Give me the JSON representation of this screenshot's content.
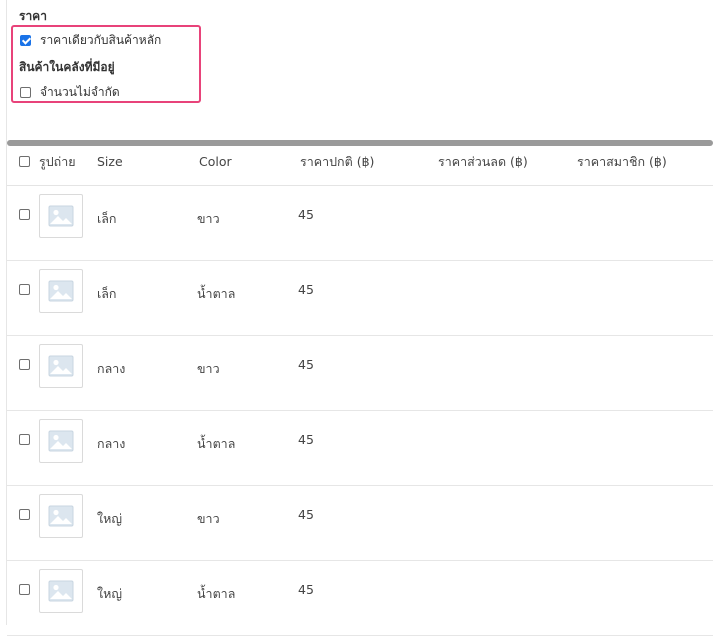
{
  "price_section": {
    "title": "ราคา",
    "same_price_label": "ราคาเดียวกับสินค้าหลัก",
    "same_price_checked": true
  },
  "stock_section": {
    "title": "สินค้าในคลังที่มีอยู่",
    "unlimited_label": "จำนวนไม่จำกัด",
    "unlimited_checked": false
  },
  "table": {
    "headers": {
      "photo": "รูปถ่าย",
      "size": "Size",
      "color": "Color",
      "regular_price": "ราคาปกติ (฿)",
      "discount_price": "ราคาส่วนลด (฿)",
      "member_price": "ราคาสมาชิก (฿)"
    },
    "rows": [
      {
        "size": "เล็ก",
        "color": "ขาว",
        "regular_price": "45"
      },
      {
        "size": "เล็ก",
        "color": "น้ำตาล",
        "regular_price": "45"
      },
      {
        "size": "กลาง",
        "color": "ขาว",
        "regular_price": "45"
      },
      {
        "size": "กลาง",
        "color": "น้ำตาล",
        "regular_price": "45"
      },
      {
        "size": "ใหญ่",
        "color": "ขาว",
        "regular_price": "45"
      },
      {
        "size": "ใหญ่",
        "color": "น้ำตาล",
        "regular_price": "45"
      }
    ]
  },
  "colors": {
    "highlight_border": "#e8437a",
    "checkbox_checked": "#1a73e8",
    "scrollbar": "#9a9a9a"
  }
}
